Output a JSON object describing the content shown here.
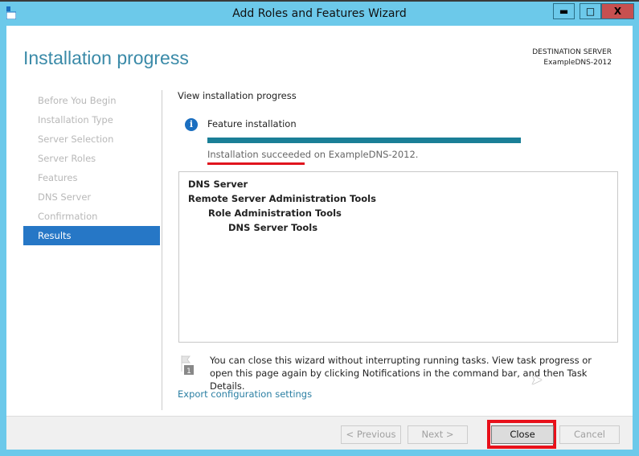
{
  "window": {
    "title": "Add Roles and Features Wizard",
    "minimize": "▬",
    "maximize": "□",
    "close": "X"
  },
  "header": {
    "title": "Installation progress",
    "dest_label": "DESTINATION SERVER",
    "dest_server": "ExampleDNS-2012"
  },
  "sidebar": {
    "items": [
      {
        "label": "Before You Begin"
      },
      {
        "label": "Installation Type"
      },
      {
        "label": "Server Selection"
      },
      {
        "label": "Server Roles"
      },
      {
        "label": "Features"
      },
      {
        "label": "DNS Server"
      },
      {
        "label": "Confirmation"
      },
      {
        "label": "Results",
        "selected": true
      }
    ]
  },
  "main": {
    "section": "View installation progress",
    "feature_label": "Feature installation",
    "progress": 100,
    "status": "Installation succeeded on ExampleDNS-2012.",
    "features": [
      "DNS Server",
      "Remote Server Administration Tools",
      "Role Administration Tools",
      "DNS Server Tools"
    ],
    "note": "You can close this wizard without interrupting running tasks. View task progress or open this page again by clicking Notifications in the command bar, and then Task Details.",
    "flag_badge": "1",
    "export_link": "Export configuration settings"
  },
  "footer": {
    "previous": "< Previous",
    "next": "Next >",
    "close": "Close",
    "cancel": "Cancel"
  },
  "colors": {
    "titlebar": "#6cc9ea",
    "accent": "#2677c6",
    "progress": "#1a7f97",
    "highlight": "#e8101a"
  }
}
